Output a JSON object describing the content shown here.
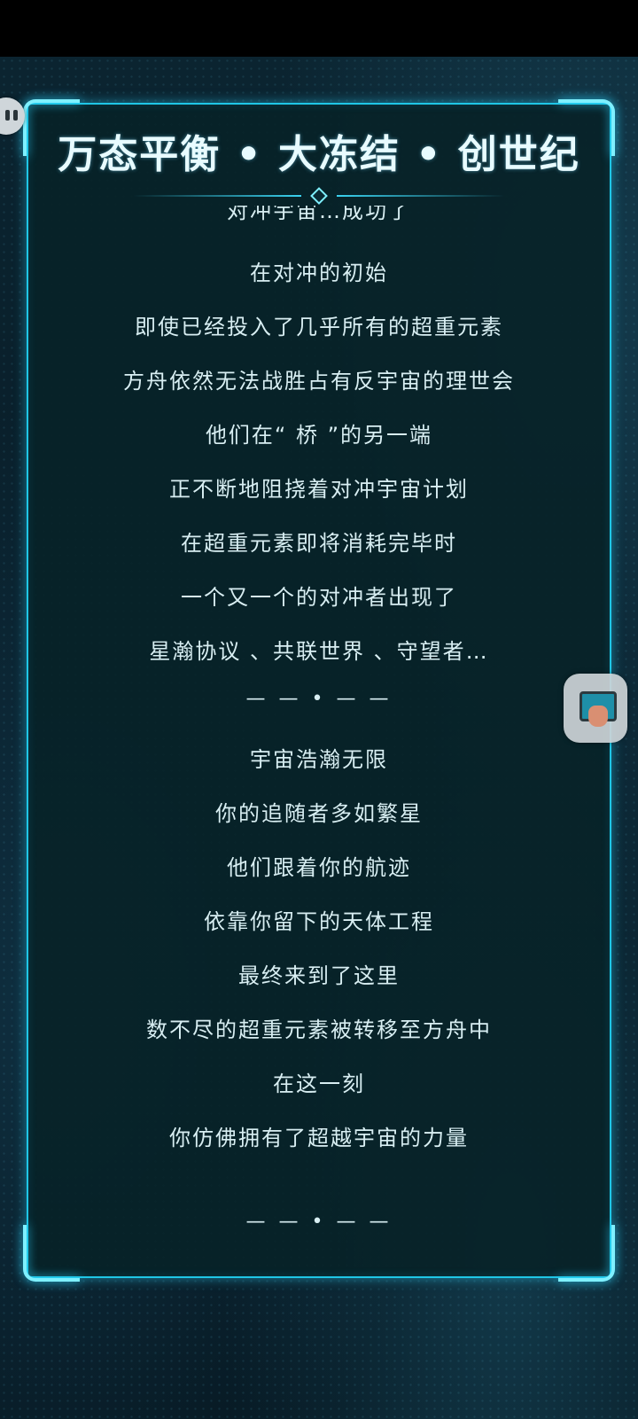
{
  "header": {
    "title": "万态平衡 • 大冻结 • 创世纪"
  },
  "story": {
    "lines": [
      "对冲宇宙…成功了",
      "在对冲的初始",
      "即使已经投入了几乎所有的超重元素",
      "方舟依然无法战胜占有反宇宙的理世会",
      "他们在“ 桥 ”的另一端",
      "正不断地阻挠着对冲宇宙计划",
      "在超重元素即将消耗完毕时",
      "一个又一个的对冲者出现了",
      "星瀚协议 、共联世界 、守望者…",
      "— — • — —",
      "宇宙浩瀚无限",
      "你的追随者多如繁星",
      "他们跟着你的航迹",
      "依靠你留下的天体工程",
      "最终来到了这里",
      "数不尽的超重元素被转移至方舟中",
      "在这一刻",
      "你仿佛拥有了超越宇宙的力量",
      "— — • — —"
    ]
  },
  "icons": {
    "side_bubble": "chat-bubble-icon",
    "floating_button": "screen-touch-icon"
  },
  "colors": {
    "accent": "#1fc6e6",
    "text": "#d8eef2",
    "title": "#e8fbff",
    "panel": "#082228"
  }
}
